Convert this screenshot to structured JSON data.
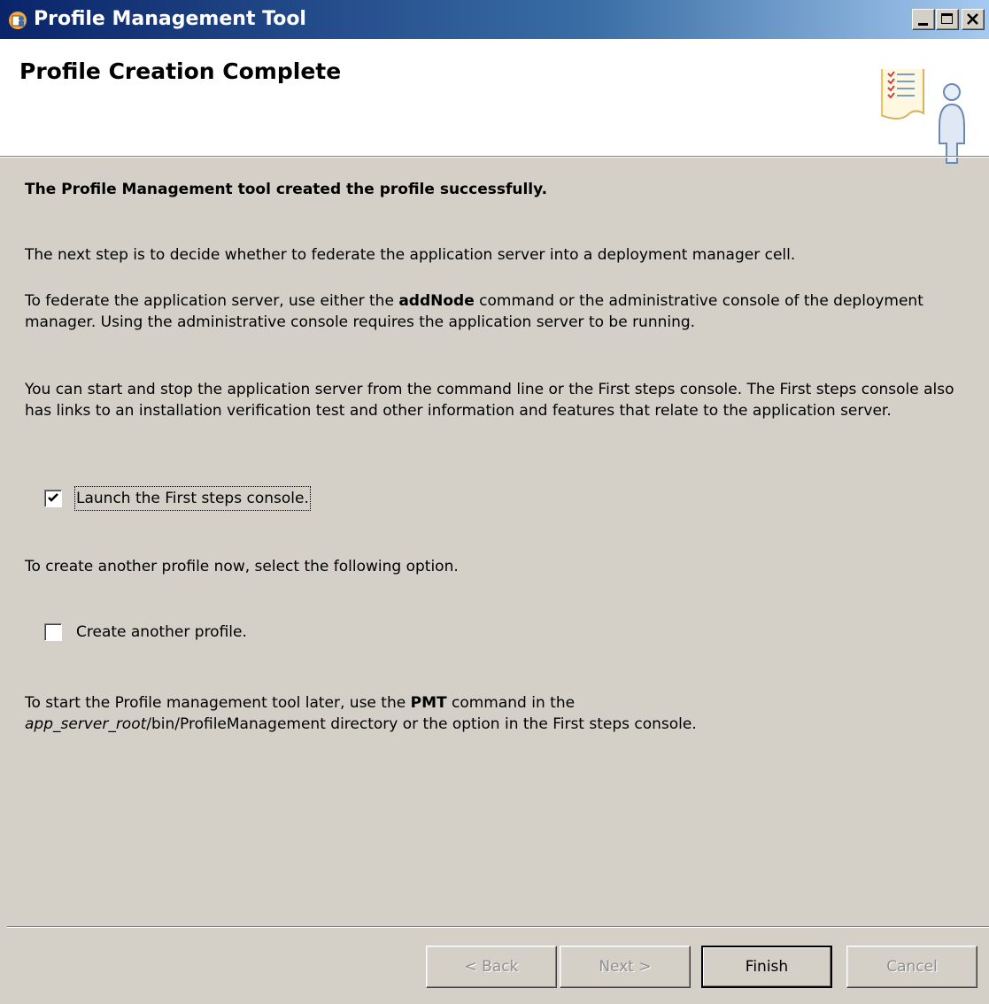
{
  "window": {
    "title": "Profile Management Tool",
    "icon": "profile-management-app-icon",
    "controls": [
      "minimize-icon",
      "maximize-icon",
      "close-icon"
    ]
  },
  "header": {
    "title": "Profile Creation Complete",
    "graphic": "checklist-person-icon"
  },
  "content": {
    "success_heading": "The Profile Management tool created the profile successfully.",
    "next_step": "The next step is to decide whether to federate the application server into a deployment manager cell.",
    "federate_pre": "To federate the application server, use either the ",
    "federate_cmd": "addNode",
    "federate_post": " command or the administrative console of the deployment manager. Using the administrative console requires the application server to be running.",
    "start_stop": "You can start and stop the application server from the command line or the First steps console. The First steps console also has links to an installation verification test and other information and features that relate to the application server.",
    "launch_checkbox": {
      "label": "Launch the First steps console.",
      "checked": true
    },
    "create_another_text": "To create another profile now, select the following option.",
    "create_checkbox": {
      "label": "Create another profile.",
      "checked": false
    },
    "pmt_pre": "To start the Profile management tool later, use the ",
    "pmt_cmd": "PMT",
    "pmt_mid": " command in the",
    "pmt_path_italic": "app_server_root",
    "pmt_path_rest": "/bin/ProfileManagement directory or the option in the First steps console."
  },
  "buttons": {
    "back": "< Back",
    "next": "Next >",
    "finish": "Finish",
    "cancel": "Cancel"
  },
  "colors": {
    "titlebar_start": "#0a246a",
    "titlebar_end": "#a6caf0",
    "dialog_bg": "#d4d0c8",
    "header_bg": "#ffffff"
  }
}
